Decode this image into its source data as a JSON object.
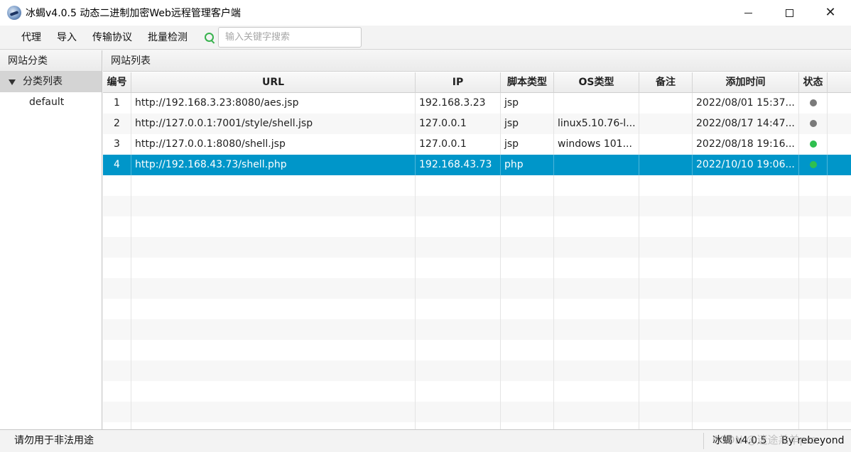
{
  "window": {
    "title": "冰蝎v4.0.5 动态二进制加密Web远程管理客户端",
    "minimize_symbol": "",
    "maximize_symbol": "",
    "close_symbol": "✕"
  },
  "menu": {
    "items": [
      {
        "label": "代理"
      },
      {
        "label": "导入"
      },
      {
        "label": "传输协议"
      },
      {
        "label": "批量检测"
      }
    ],
    "search": {
      "placeholder": "输入关键字搜索",
      "value": ""
    }
  },
  "left_panel": {
    "header": "网站分类",
    "tree_root": "分类列表",
    "tree_children": [
      {
        "label": "default"
      }
    ]
  },
  "right_panel": {
    "header": "网站列表",
    "columns": [
      "编号",
      "URL",
      "IP",
      "脚本类型",
      "OS类型",
      "备注",
      "添加时间",
      "状态",
      ""
    ],
    "rows": [
      {
        "num": "1",
        "url": "http://192.168.3.23:8080/aes.jsp",
        "ip": "192.168.3.23",
        "type": "jsp",
        "os": "",
        "note": "",
        "time": "2022/08/01 15:37...",
        "status_color": "#7a7a7a"
      },
      {
        "num": "2",
        "url": "http://127.0.0.1:7001/style/shell.jsp",
        "ip": "127.0.0.1",
        "type": "jsp",
        "os": "linux5.10.76-l...",
        "note": "",
        "time": "2022/08/17 14:47...",
        "status_color": "#7a7a7a"
      },
      {
        "num": "3",
        "url": "http://127.0.0.1:8080/shell.jsp",
        "ip": "127.0.0.1",
        "type": "jsp",
        "os": "windows 101...",
        "note": "",
        "time": "2022/08/18 19:16...",
        "status_color": "#2fbf4f"
      },
      {
        "num": "4",
        "url": "http://192.168.43.73/shell.php",
        "ip": "192.168.43.73",
        "type": "php",
        "os": "",
        "note": "",
        "time": "2022/10/10 19:06...",
        "status_color": "#2fbf4f",
        "selected": true
      }
    ],
    "empty_row_count": 13
  },
  "status_bar": {
    "left_text": "请勿用于非法用途",
    "version": "冰蝎 v4.0.5",
    "author": "By rebeyond",
    "watermark": "CSDN @迷途羔羊pro"
  },
  "colors": {
    "selected_row": "#0096c9",
    "search_icon": "#37b24d"
  }
}
